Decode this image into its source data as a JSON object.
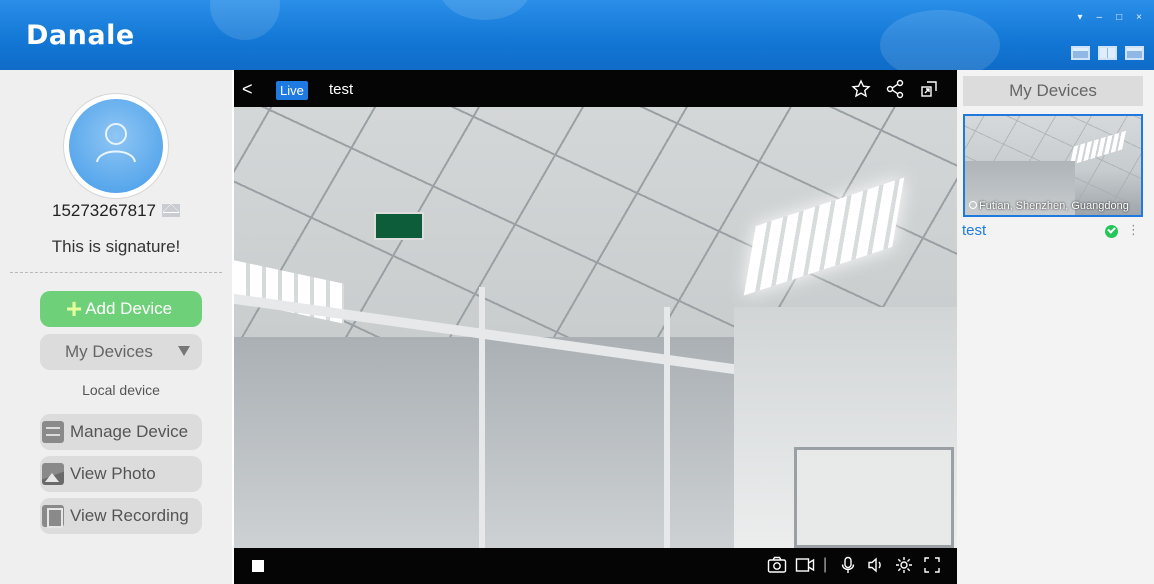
{
  "app": {
    "title": "Danale",
    "window_controls": [
      "▾",
      "–",
      "□",
      "×"
    ]
  },
  "sidebar": {
    "phone": "15273267817",
    "signature": "This is signature!",
    "add_device_label": "Add Device",
    "my_devices_label": "My Devices",
    "local_device_label": "Local device",
    "manage_device_label": "Manage Device",
    "view_photo_label": "View Photo",
    "view_recording_label": "View Recording"
  },
  "video": {
    "back_glyph": "<",
    "live_badge": "Live",
    "camera_name": "test",
    "bottom_separator": "|"
  },
  "right_panel": {
    "header": "My Devices",
    "devices": [
      {
        "name": "test",
        "location": "Futian, Shenzhen, Guangdong",
        "status": "online"
      }
    ],
    "more_glyph": "⋮"
  },
  "colors": {
    "titlebar": "#1478d6",
    "accent": "#1f7ae0",
    "add_button": "#6fd07a",
    "online": "#25c55a"
  }
}
